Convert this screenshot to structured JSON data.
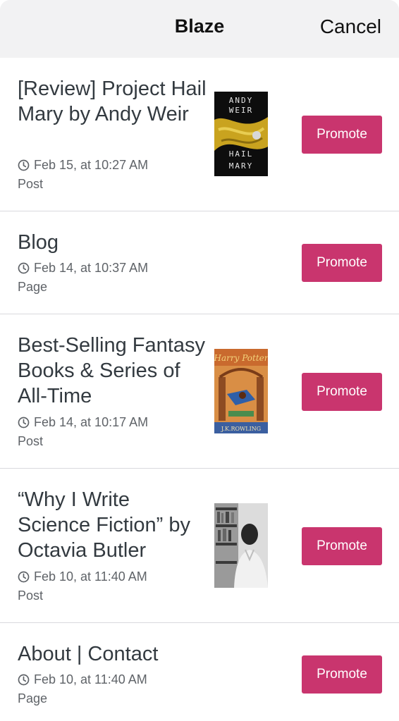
{
  "header": {
    "title": "Blaze",
    "cancel_label": "Cancel"
  },
  "promote_label": "Promote",
  "colors": {
    "accent": "#c9356e",
    "header_bg": "#f2f2f3",
    "divider": "#d9d9de"
  },
  "posts": [
    {
      "title": "[Review] Project Hail Mary by Andy Weir",
      "date": "Feb 15, at 10:27 AM",
      "type": "Post",
      "thumbnail": "book-cover-project-hail-mary"
    },
    {
      "title": "Blog",
      "date": "Feb 14, at 10:37 AM",
      "type": "Page",
      "thumbnail": ""
    },
    {
      "title": "Best-Selling Fantasy Books & Series of All-Time",
      "date": "Feb 14, at 10:17 AM",
      "type": "Post",
      "thumbnail": "book-cover-harry-potter"
    },
    {
      "title": "“Why I Write Science Fiction” by Octavia Butler",
      "date": "Feb 10, at 11:40 AM",
      "type": "Post",
      "thumbnail": "photo-octavia-butler"
    },
    {
      "title": "About | Contact",
      "date": "Feb 10, at 11:40 AM",
      "type": "Page",
      "thumbnail": ""
    }
  ]
}
